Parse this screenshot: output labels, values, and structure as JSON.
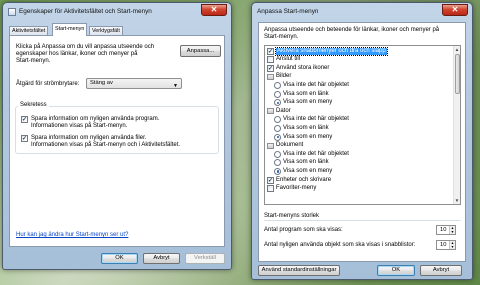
{
  "window1": {
    "title": "Egenskaper för Aktivitetsfältet och Start-menyn",
    "close_glyph": "✕",
    "tabs": [
      "Aktivitetsfältet",
      "Start-menyn",
      "Verktygsfält"
    ],
    "intro": [
      "Klicka på Anpassa om du vill anpassa utseende och",
      "egenskaper hos länkar, ikoner och menyer på",
      "Start-menyn."
    ],
    "customize_button": "Anpassa...",
    "power_label": "Åtgärd för strömbrytare:",
    "power_value": "Stäng av",
    "privacy_label": "Sekretess",
    "privacy_items": [
      {
        "lines": [
          "Spara information om nyligen använda program.",
          "Informationen visas på Start-menyn."
        ],
        "checked": true
      },
      {
        "lines": [
          "Spara information om nyligen använda filer.",
          "Informationen visas på Start-menyn och i Aktivitetsfältet."
        ],
        "checked": true
      }
    ],
    "help_link": "Hur kan jag ändra hur Start-menyn ser ut?",
    "buttons": {
      "ok": "OK",
      "cancel": "Avbryt",
      "apply": "Verkställ"
    }
  },
  "window2": {
    "title": "Anpassa Start-menyn",
    "close_glyph": "✕",
    "intro": [
      "Anpassa utseende och beteende för länkar, ikoner och menyer på",
      "Start-menyn."
    ],
    "list": [
      {
        "type": "check",
        "label": "Aktivera snabbmenyer och dra och släpp",
        "checked": true,
        "selected": true
      },
      {
        "type": "check",
        "label": "Anslut till",
        "checked": false
      },
      {
        "type": "check",
        "label": "Använd stora ikoner",
        "checked": true
      },
      {
        "type": "header",
        "label": "Bilder"
      },
      {
        "type": "radio",
        "label": "Visa inte det här objektet",
        "checked": false
      },
      {
        "type": "radio",
        "label": "Visa som en länk",
        "checked": false
      },
      {
        "type": "radio",
        "label": "Visa som en meny",
        "checked": true
      },
      {
        "type": "header",
        "label": "Dator"
      },
      {
        "type": "radio",
        "label": "Visa inte det här objektet",
        "checked": false
      },
      {
        "type": "radio",
        "label": "Visa som en länk",
        "checked": false
      },
      {
        "type": "radio",
        "label": "Visa som en meny",
        "checked": true
      },
      {
        "type": "header",
        "label": "Dokument"
      },
      {
        "type": "radio",
        "label": "Visa inte det här objektet",
        "checked": false
      },
      {
        "type": "radio",
        "label": "Visa som en länk",
        "checked": false
      },
      {
        "type": "radio",
        "label": "Visa som en meny",
        "checked": true
      },
      {
        "type": "check",
        "label": "Enheter och skrivare",
        "checked": true
      },
      {
        "type": "check",
        "label": "Favoriter-meny",
        "checked": false
      }
    ],
    "size_group_label": "Start-menyns storlek",
    "recent_programs_label": "Antal program som ska visas:",
    "recent_programs_value": "10",
    "recent_items_label": "Antal nyligen använda objekt som ska visas i snabblistor:",
    "recent_items_value": "10",
    "buttons": {
      "defaults": "Använd standardinställningar",
      "ok": "OK",
      "cancel": "Avbryt"
    }
  }
}
